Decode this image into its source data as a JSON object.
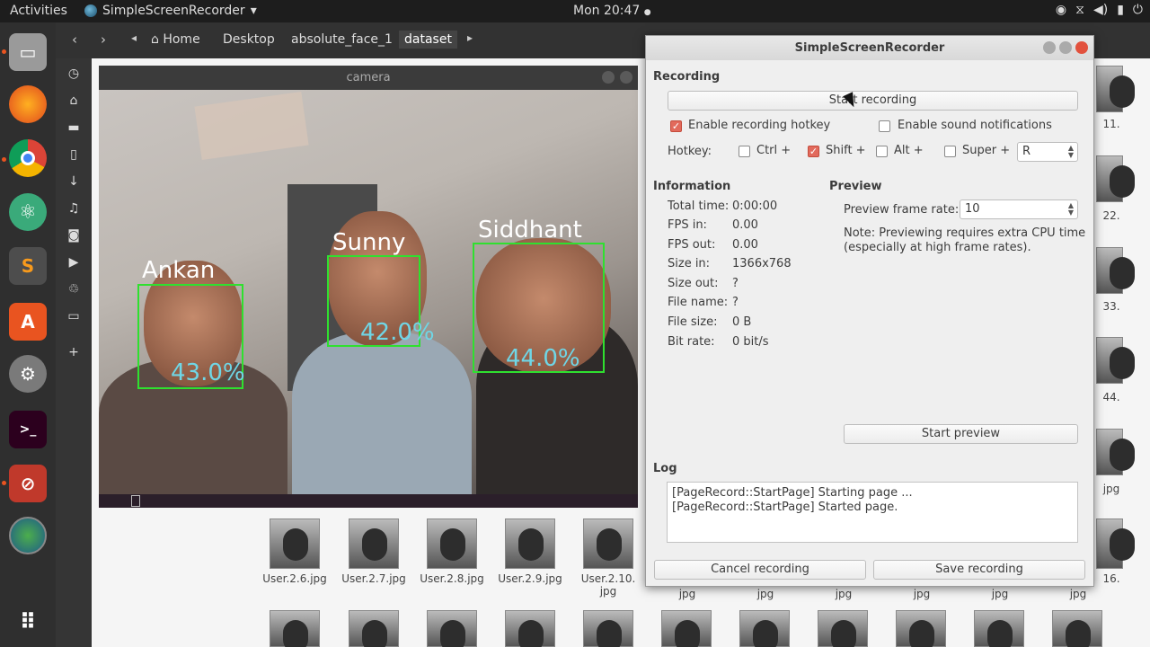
{
  "topbar": {
    "activities": "Activities",
    "app_name": "SimpleScreenRecorder",
    "app_menu_arrow": "▾",
    "clock": "Mon 20:47",
    "clock_dot": "●",
    "tray_icons": [
      "indicator-icon",
      "network-icon",
      "volume-icon",
      "battery-icon",
      "power-icon"
    ]
  },
  "dock": {
    "items": [
      "files-icon",
      "firefox-icon",
      "chrome-icon",
      "atom-icon",
      "sublime-icon",
      "software-center-icon",
      "settings-icon",
      "terminal-icon",
      "recorder-icon",
      "camera-app-icon"
    ],
    "show_apps_icon": "grid-icon"
  },
  "filemanager": {
    "back": "‹",
    "forward": "›",
    "crumb_left_arrow": "◂",
    "crumbs": [
      "Home",
      "Desktop",
      "absolute_face_1",
      "dataset"
    ],
    "crumb_right_arrow": "▸",
    "files_row1": [
      "User.2.6.jpg",
      "User.2.7.jpg",
      "User.2.8.jpg",
      "User.2.9.jpg",
      "User.2.10.\njpg"
    ],
    "files_row1_partial": [
      "jpg",
      "jpg",
      "jpg",
      "jpg",
      "jpg",
      "jpg"
    ],
    "right_edge_labels": [
      "11.",
      "22.",
      "33.",
      "44.",
      "jpg",
      "16."
    ]
  },
  "camera": {
    "title": "camera",
    "faces": [
      {
        "name": "Ankan",
        "confidence": "43.0%"
      },
      {
        "name": "Sunny",
        "confidence": "42.0%"
      },
      {
        "name": "Siddhant",
        "confidence": "44.0%"
      }
    ]
  },
  "ssr": {
    "title": "SimpleScreenRecorder",
    "recording": {
      "heading": "Recording",
      "start_button": "Start recording",
      "enable_hotkey": {
        "label": "Enable recording hotkey",
        "checked": true
      },
      "enable_sound": {
        "label": "Enable sound notifications",
        "checked": false
      },
      "hotkey_label": "Hotkey:",
      "ctrl": {
        "label": "Ctrl +",
        "checked": false
      },
      "shift": {
        "label": "Shift +",
        "checked": true
      },
      "alt": {
        "label": "Alt +",
        "checked": false
      },
      "super": {
        "label": "Super +",
        "checked": false
      },
      "key": "R"
    },
    "information": {
      "heading": "Information",
      "rows": [
        {
          "label": "Total time:",
          "value": "0:00:00"
        },
        {
          "label": "FPS in:",
          "value": "0.00"
        },
        {
          "label": "FPS out:",
          "value": "0.00"
        },
        {
          "label": "Size in:",
          "value": "1366x768"
        },
        {
          "label": "Size out:",
          "value": "?"
        },
        {
          "label": "File name:",
          "value": "?"
        },
        {
          "label": "File size:",
          "value": "0 B"
        },
        {
          "label": "Bit rate:",
          "value": "0 bit/s"
        }
      ]
    },
    "preview": {
      "heading": "Preview",
      "frame_rate_label": "Preview frame rate:",
      "frame_rate_value": "10",
      "note_line1": "Note: Previewing requires extra CPU time",
      "note_line2": "(especially at high frame rates).",
      "start_preview": "Start preview"
    },
    "log": {
      "heading": "Log",
      "lines": [
        "[PageRecord::StartPage] Starting page ...",
        "[PageRecord::StartPage] Started page."
      ]
    },
    "cancel_button": "Cancel recording",
    "save_button": "Save recording",
    "check_mark": "✓"
  }
}
